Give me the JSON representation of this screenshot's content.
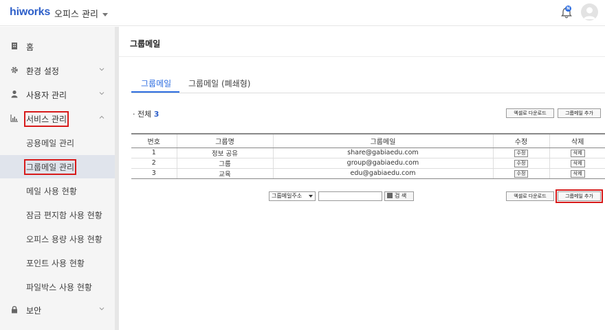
{
  "header": {
    "logo": "hiworks",
    "office_menu": "오피스 관리",
    "notification_badge": "N"
  },
  "sidebar": {
    "items": [
      {
        "label": "홈",
        "icon": "building-icon"
      },
      {
        "label": "환경 설정",
        "icon": "gear-icon"
      },
      {
        "label": "사용자 관리",
        "icon": "user-icon"
      },
      {
        "label": "서비스 관리",
        "icon": "chart-icon"
      },
      {
        "label": "보안",
        "icon": "lock-icon"
      }
    ],
    "sub_items": [
      {
        "label": "공용메일 관리"
      },
      {
        "label": "그룹메일 관리"
      },
      {
        "label": "메일 사용 현황"
      },
      {
        "label": "잠금 편지함 사용 현황"
      },
      {
        "label": "오피스 용량 사용 현황"
      },
      {
        "label": "포인트 사용 현황"
      },
      {
        "label": "파일박스 사용 현황"
      }
    ]
  },
  "main": {
    "page_title": "그룹메일",
    "tabs": [
      {
        "label": "그룹메일"
      },
      {
        "label": "그룹메일 (폐쇄형)"
      }
    ],
    "total_label": "· 전체",
    "total_count": "3",
    "buttons": {
      "excel_export": "엑셀로 다운로드",
      "add_group_mail": "그룹메일 추가",
      "search": "검 색"
    },
    "table": {
      "headers": [
        "번호",
        "그룹명",
        "그룹메일",
        "수정",
        "삭제"
      ],
      "rows": [
        {
          "no": "1",
          "name": "정보 공유",
          "email": "share@gabiaedu.com",
          "edit": "수정",
          "delete": "삭제"
        },
        {
          "no": "2",
          "name": "그룹",
          "email": "group@gabiaedu.com",
          "edit": "수정",
          "delete": "삭제"
        },
        {
          "no": "3",
          "name": "교육",
          "email": "edu@gabiaedu.com",
          "edit": "수정",
          "delete": "삭제"
        }
      ]
    },
    "search": {
      "select_value": "그룹메일주소",
      "input_value": ""
    }
  },
  "colors": {
    "brand": "#2d5fc9",
    "accent": "#2d6de0",
    "highlight_box": "#d71a1a",
    "sidebar_bg": "#f5f5f5",
    "active_sub_bg": "#e0e4ec"
  }
}
